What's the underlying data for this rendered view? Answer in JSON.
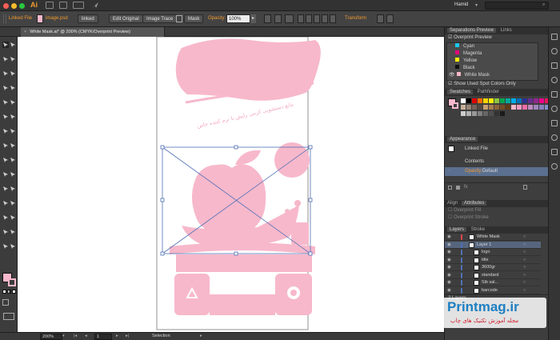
{
  "titlebar": {
    "app_logo": "Ai",
    "user": "Hamid",
    "search_icon": "search-icon"
  },
  "controlbar": {
    "linked_file": "Linked File",
    "filename": "image.psd",
    "linked": "linked",
    "edit_original": "Edit Original",
    "image_trace": "Image Trace",
    "mask": "Mask",
    "opacity_label": "Opacity:",
    "opacity_value": "100%",
    "transform": "Transform"
  },
  "document": {
    "tab_title": "White Mask.ai* @ 200% (CMYK/Overprint Preview)"
  },
  "artwork": {
    "headline_text": "مانع دستشویی کرمی رایش با نرم کننده خاص"
  },
  "status": {
    "zoom": "200%",
    "artboard": "1",
    "tool": "Selection"
  },
  "separations": {
    "tab_active": "Separations Preview",
    "tab_links": "Links",
    "overprint_preview": "Overprint Preview",
    "inks": [
      "Cyan",
      "Magenta",
      "Yellow",
      "Black",
      "White Mask"
    ],
    "ink_colors": [
      "#1cc7f0",
      "#e3007e",
      "#ffed00",
      "#111111",
      "#f4b6c8"
    ],
    "show_used": "Show Used Spot Colors Only"
  },
  "swatches": {
    "tab_active": "Swatches",
    "tab_other": "Pathfinder"
  },
  "appearance": {
    "title": "Appearance",
    "linked_file": "Linked File",
    "contents": "Contents",
    "opacity_label": "Opacity:",
    "opacity_value": "Default"
  },
  "align": {
    "tab_align": "Align",
    "tab_attributes": "Attributes",
    "overprint_fill": "Overprint Fill",
    "overprint_stroke": "Overprint Stroke"
  },
  "layers": {
    "tab_active": "Layers",
    "tab_other": "Stroke",
    "rows": [
      "White Mask",
      "Layer 1",
      "logo",
      "title",
      "3600gr",
      "standard",
      "Sib sal...",
      "barcode"
    ],
    "count": "2 Layers"
  },
  "watermark": {
    "brand": "Printmag.ir",
    "tagline": "مجله آموزش تکنیک های چاپ"
  },
  "colors": {
    "pink": "#f7b8cb",
    "selection": "#4f6fb5",
    "orange": "#f39a2f"
  }
}
